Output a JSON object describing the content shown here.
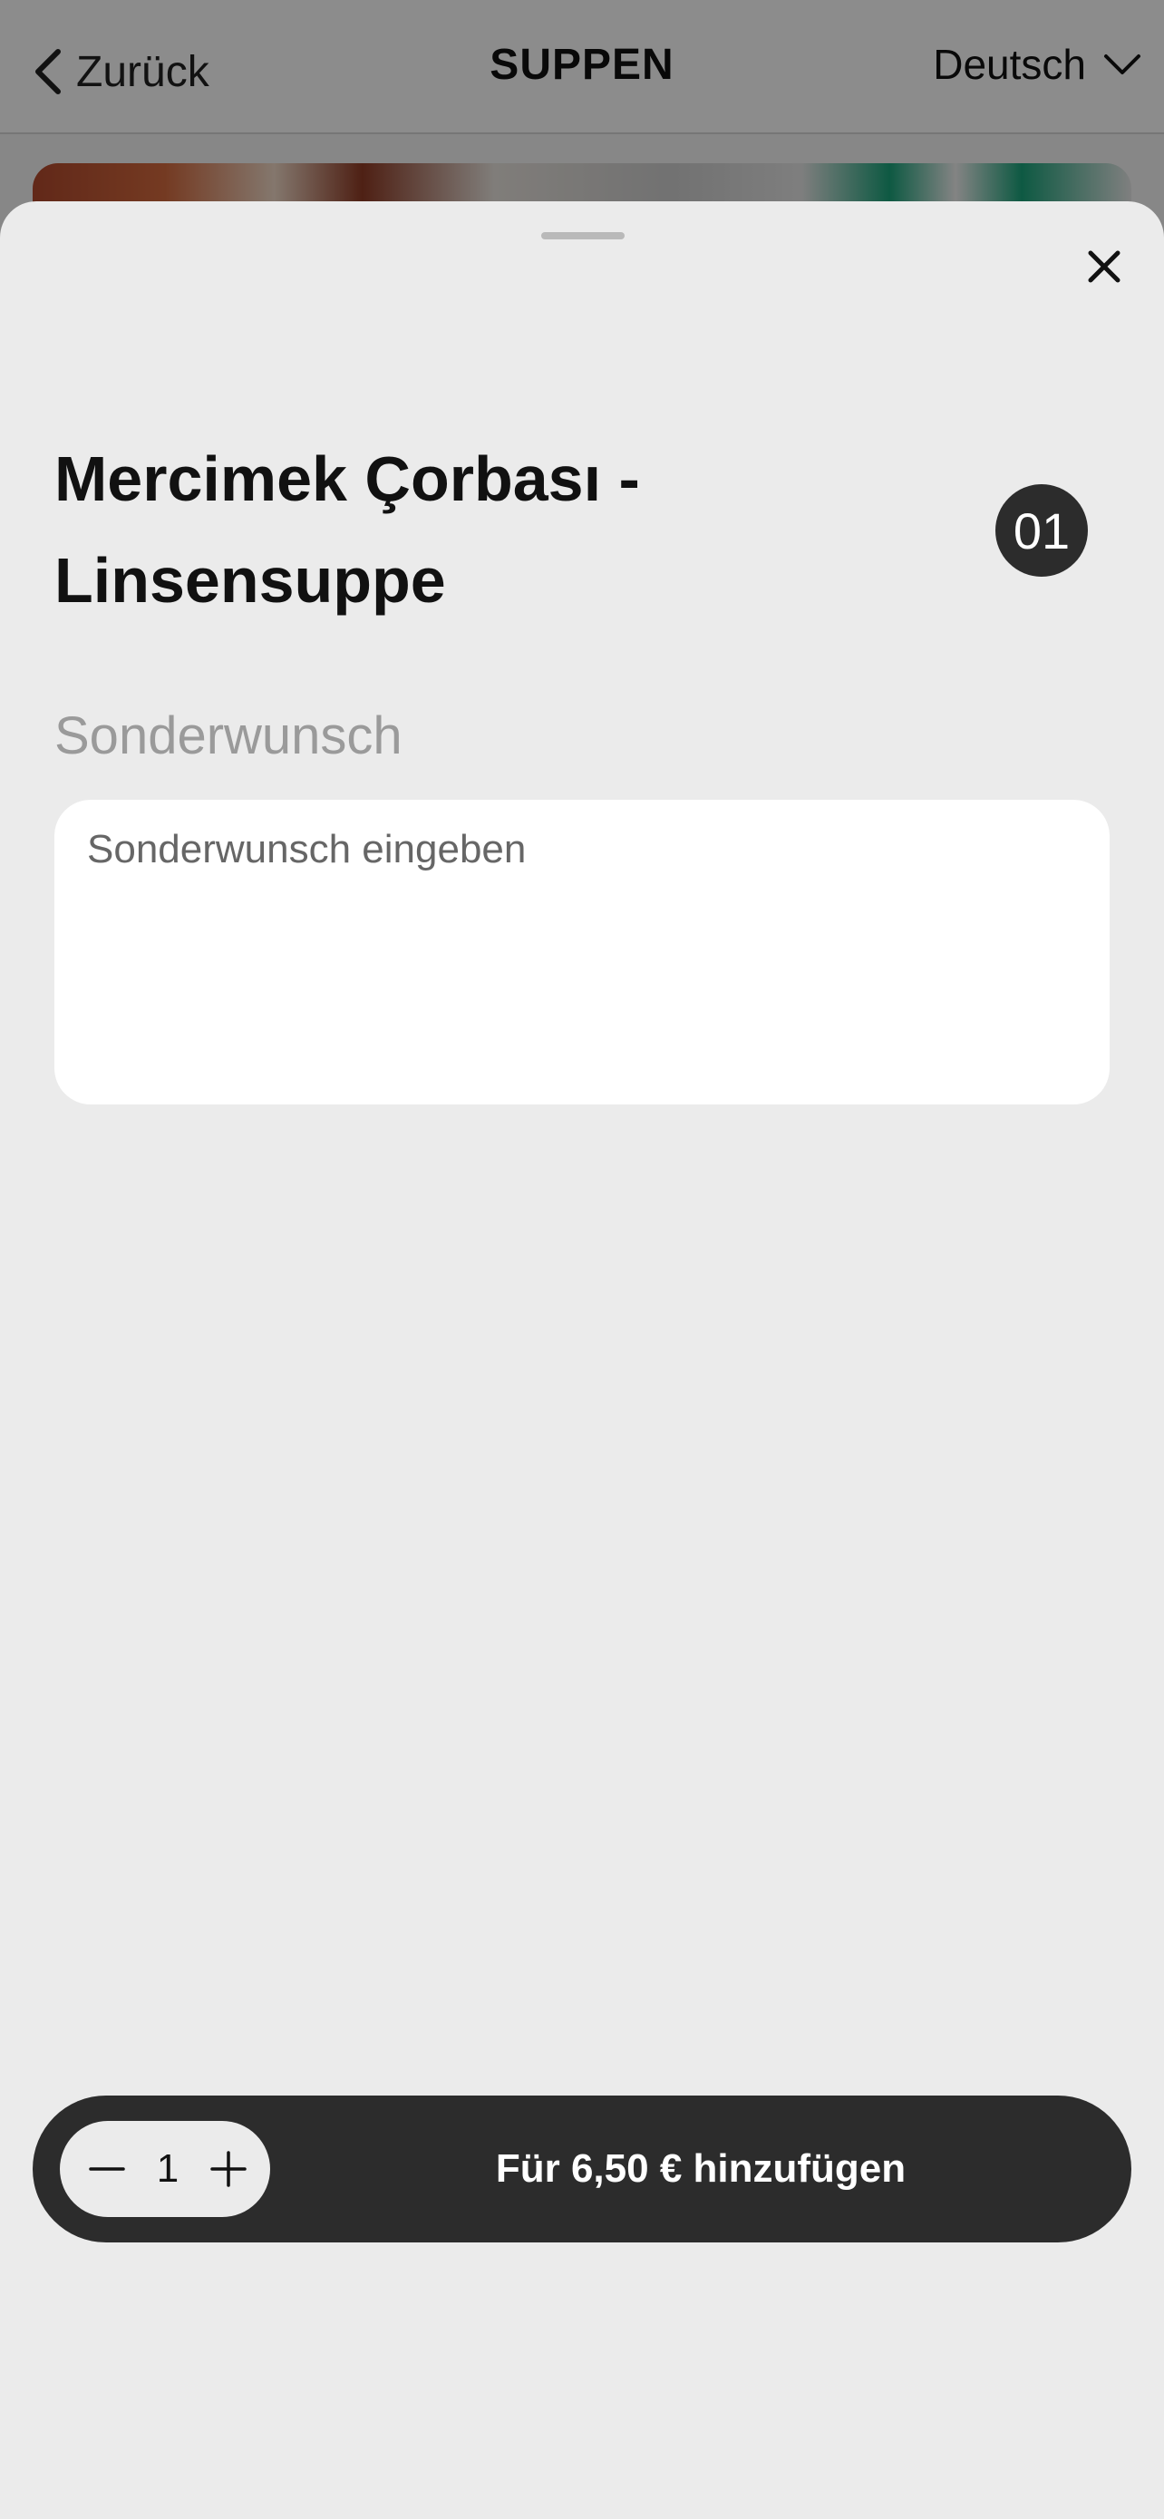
{
  "header": {
    "back_label": "Zurück",
    "title": "SUPPEN",
    "language": "Deutsch"
  },
  "product": {
    "name": "Mercimek Çorbası - Linsensuppe",
    "number": "01"
  },
  "special_request": {
    "label": "Sonderwunsch",
    "placeholder": "Sonderwunsch eingeben",
    "value": ""
  },
  "action_bar": {
    "quantity": "1",
    "add_label": "Für 6,50 € hinzufügen"
  },
  "icons": {
    "back": "chevron-left-icon",
    "language": "chevron-down-icon",
    "close": "close-icon",
    "decrement": "minus-icon",
    "increment": "plus-icon"
  },
  "colors": {
    "sheet_background": "#ebebeb",
    "action_bar": "#2c2c2c",
    "badge": "#2c2c2c",
    "muted_label": "#9a9a9a"
  }
}
